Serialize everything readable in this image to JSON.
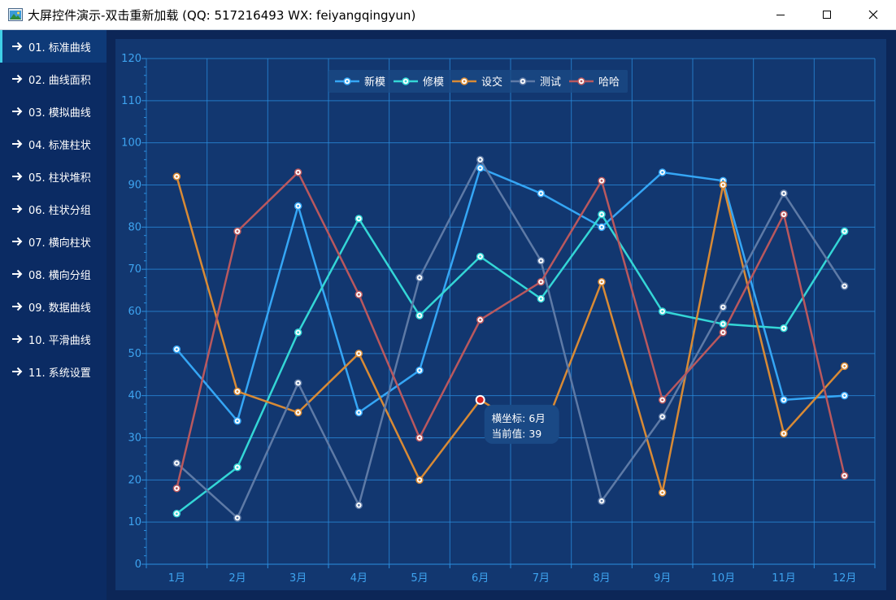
{
  "window": {
    "title": "大屏控件演示-双击重新加载 (QQ: 517216493  WX: feiyangqingyun)",
    "controls": [
      "minimize-icon",
      "maximize-icon",
      "close-icon"
    ]
  },
  "sidebar": {
    "items": [
      {
        "label": "01. 标准曲线",
        "icon": "arrow-right-icon",
        "active": true
      },
      {
        "label": "02. 曲线面积",
        "icon": "arrow-right-icon"
      },
      {
        "label": "03. 模拟曲线",
        "icon": "arrow-right-icon"
      },
      {
        "label": "04. 标准柱状",
        "icon": "arrow-right-icon"
      },
      {
        "label": "05. 柱状堆积",
        "icon": "arrow-right-icon"
      },
      {
        "label": "06. 柱状分组",
        "icon": "arrow-right-icon"
      },
      {
        "label": "07. 横向柱状",
        "icon": "arrow-right-icon"
      },
      {
        "label": "08. 横向分组",
        "icon": "arrow-right-icon"
      },
      {
        "label": "09. 数据曲线",
        "icon": "arrow-right-icon"
      },
      {
        "label": "10. 平滑曲线",
        "icon": "arrow-right-icon"
      },
      {
        "label": "11. 系统设置",
        "icon": "arrow-right-icon"
      }
    ]
  },
  "colors": {
    "background": "#0c2657",
    "sidebar": "#0b2b63",
    "panel": "#123770",
    "grid": "#2b8fe0",
    "axis_text": "#3ea4f0",
    "highlight": "#d41f1f"
  },
  "chart_data": {
    "type": "line",
    "categories": [
      "1月",
      "2月",
      "3月",
      "4月",
      "5月",
      "6月",
      "7月",
      "8月",
      "9月",
      "10月",
      "11月",
      "12月"
    ],
    "ylim": [
      0,
      120
    ],
    "yticks": [
      0,
      10,
      20,
      30,
      40,
      50,
      60,
      70,
      80,
      90,
      100,
      110,
      120
    ],
    "grid": true,
    "legend_position": "top-center",
    "series": [
      {
        "name": "新模",
        "color": "#35a6f5",
        "values": [
          51,
          34,
          85,
          36,
          46,
          94,
          88,
          80,
          93,
          91,
          39,
          40
        ]
      },
      {
        "name": "修模",
        "color": "#34d6d6",
        "values": [
          12,
          23,
          55,
          82,
          59,
          73,
          63,
          83,
          60,
          57,
          56,
          79
        ]
      },
      {
        "name": "设交",
        "color": "#d88a35",
        "values": [
          92,
          41,
          36,
          50,
          20,
          39,
          30,
          67,
          17,
          90,
          31,
          47
        ]
      },
      {
        "name": "测试",
        "color": "#5e7aa6",
        "values": [
          24,
          11,
          43,
          14,
          68,
          96,
          72,
          15,
          35,
          61,
          88,
          66
        ]
      },
      {
        "name": "哈哈",
        "color": "#b9585e",
        "values": [
          18,
          79,
          93,
          64,
          30,
          58,
          67,
          91,
          39,
          55,
          83,
          21
        ]
      }
    ],
    "tooltip": {
      "series_index": 2,
      "point_index": 5,
      "lines": [
        "横坐标: 6月",
        "当前值: 39"
      ]
    }
  }
}
